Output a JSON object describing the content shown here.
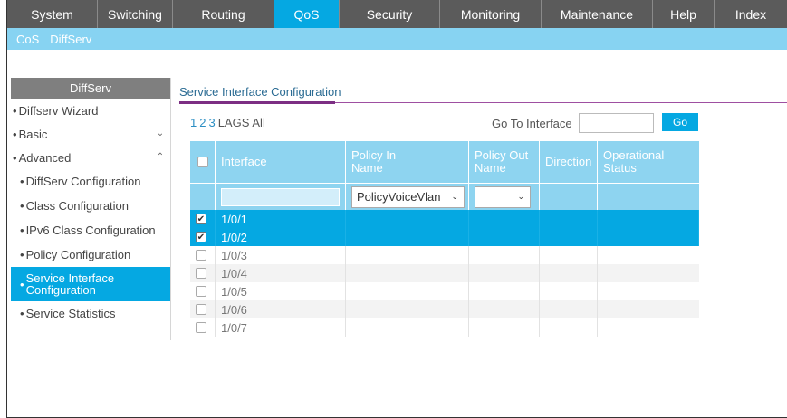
{
  "topnav": [
    {
      "label": "System",
      "width": 100
    },
    {
      "label": "Switching",
      "width": 83
    },
    {
      "label": "Routing",
      "width": 112
    },
    {
      "label": "QoS",
      "width": 72,
      "active": true
    },
    {
      "label": "Security",
      "width": 111
    },
    {
      "label": "Monitoring",
      "width": 112
    },
    {
      "label": "Maintenance",
      "width": 123
    },
    {
      "label": "Help",
      "width": 68
    },
    {
      "label": "Index",
      "width": 81
    }
  ],
  "subnav": [
    "CoS",
    "DiffServ"
  ],
  "sidebar": {
    "header": "DiffServ",
    "items": [
      {
        "label": "Diffserv Wizard",
        "sub": false
      },
      {
        "label": "Basic",
        "sub": false,
        "chevron": "down"
      },
      {
        "label": "Advanced",
        "sub": false,
        "chevron": "up"
      },
      {
        "label": "DiffServ Configuration",
        "sub": true
      },
      {
        "label": "Class Configuration",
        "sub": true
      },
      {
        "label": "IPv6 Class Configuration",
        "sub": true
      },
      {
        "label": "Policy Configuration",
        "sub": true
      },
      {
        "label": "Service Interface Configuration",
        "sub": true,
        "active": true
      },
      {
        "label": "Service Statistics",
        "sub": true
      }
    ]
  },
  "main": {
    "title": "Service Interface Configuration",
    "pages": [
      "1",
      "2",
      "3",
      "LAGS",
      "All"
    ],
    "goto_label": "Go To Interface",
    "goto_value": "",
    "go_button": "Go"
  },
  "table": {
    "headers": [
      "Interface",
      "Policy In Name",
      "Policy Out Name",
      "Direction",
      "Operational Status"
    ],
    "filter": {
      "interface_value": "",
      "policy_in": "PolicyVoiceVlan",
      "policy_out": ""
    },
    "rows": [
      {
        "interface": "1/0/1",
        "checked": true
      },
      {
        "interface": "1/0/2",
        "checked": true
      },
      {
        "interface": "1/0/3",
        "checked": false
      },
      {
        "interface": "1/0/4",
        "checked": false
      },
      {
        "interface": "1/0/5",
        "checked": false
      },
      {
        "interface": "1/0/6",
        "checked": false
      },
      {
        "interface": "1/0/7",
        "checked": false
      }
    ]
  }
}
